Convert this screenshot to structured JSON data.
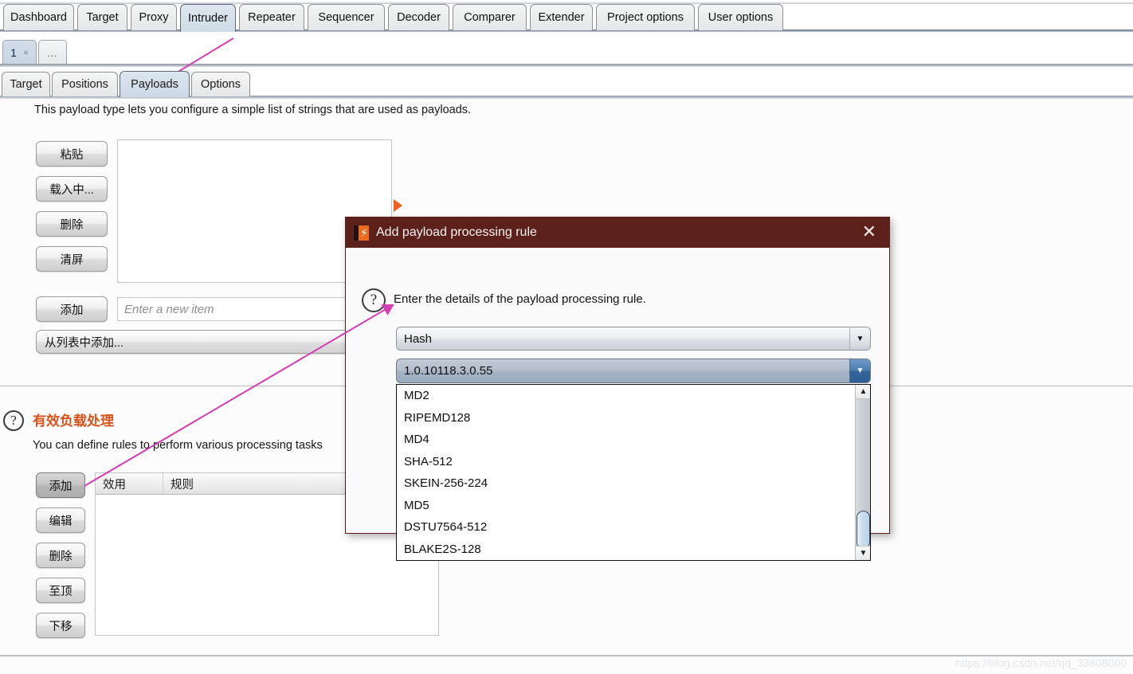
{
  "app": {
    "main_tabs": [
      {
        "label": "Dashboard",
        "active": false
      },
      {
        "label": "Target",
        "active": false
      },
      {
        "label": "Proxy",
        "active": false
      },
      {
        "label": "Intruder",
        "active": true
      },
      {
        "label": "Repeater",
        "active": false
      },
      {
        "label": "Sequencer",
        "active": false
      },
      {
        "label": "Decoder",
        "active": false
      },
      {
        "label": "Comparer",
        "active": false
      },
      {
        "label": "Extender",
        "active": false
      },
      {
        "label": "Project options",
        "active": false
      },
      {
        "label": "User options",
        "active": false
      }
    ],
    "attack_tabs": {
      "number_tab": "1",
      "close_glyph": "×",
      "more_tab": "..."
    },
    "payload_tabs": [
      {
        "label": "Target",
        "active": false
      },
      {
        "label": "Positions",
        "active": false
      },
      {
        "label": "Payloads",
        "active": true
      },
      {
        "label": "Options",
        "active": false
      }
    ]
  },
  "payload_options": {
    "description": "This payload type lets you configure a simple list of strings that are used as payloads.",
    "buttons": [
      {
        "label": "粘贴",
        "name": "paste-button"
      },
      {
        "label": "载入中...",
        "name": "load-button"
      },
      {
        "label": "删除",
        "name": "remove-button"
      },
      {
        "label": "清屏",
        "name": "clear-button"
      }
    ],
    "add_button": "添加",
    "new_item_placeholder": "Enter a new item",
    "add_from_list_button": "从列表中添加..."
  },
  "payload_processing": {
    "title": "有效负载处理",
    "help_glyph": "?",
    "description": "You can define rules to perform various processing tasks",
    "buttons": [
      {
        "label": "添加",
        "name": "rule-add-button",
        "pressed": true
      },
      {
        "label": "编辑",
        "name": "rule-edit-button",
        "pressed": false
      },
      {
        "label": "删除",
        "name": "rule-remove-button",
        "pressed": false
      },
      {
        "label": "至顶",
        "name": "rule-up-button",
        "pressed": false
      },
      {
        "label": "下移",
        "name": "rule-down-button",
        "pressed": false
      }
    ],
    "table_headers": [
      "效用",
      "规则"
    ],
    "table_rows": []
  },
  "dialog": {
    "title": "Add payload processing rule",
    "close_glyph": "✕",
    "help_glyph": "?",
    "prompt": "Enter the details of the payload processing rule.",
    "rule_type_combo": {
      "value": "Hash",
      "arrow_glyph": "▼"
    },
    "hash_combo": {
      "value": "1.0.10118.3.0.55",
      "arrow_glyph": "▼"
    },
    "dropdown_items": [
      "MD2",
      "RIPEMD128",
      "MD4",
      "SHA-512",
      "SKEIN-256-224",
      "MD5",
      "DSTU7564-512",
      "BLAKE2S-128"
    ],
    "scroll_up_glyph": "▲",
    "scroll_down_glyph": "▼"
  },
  "watermark": "https://blog.csdn.net/qq_33608000",
  "colors": {
    "dialog_title_bg": "#5c211b",
    "accent_orange": "#f4601e",
    "section_title": "#d9521a",
    "annotation_arrow": "#d63cb4",
    "active_tab_bg": "#d5e0ea"
  }
}
